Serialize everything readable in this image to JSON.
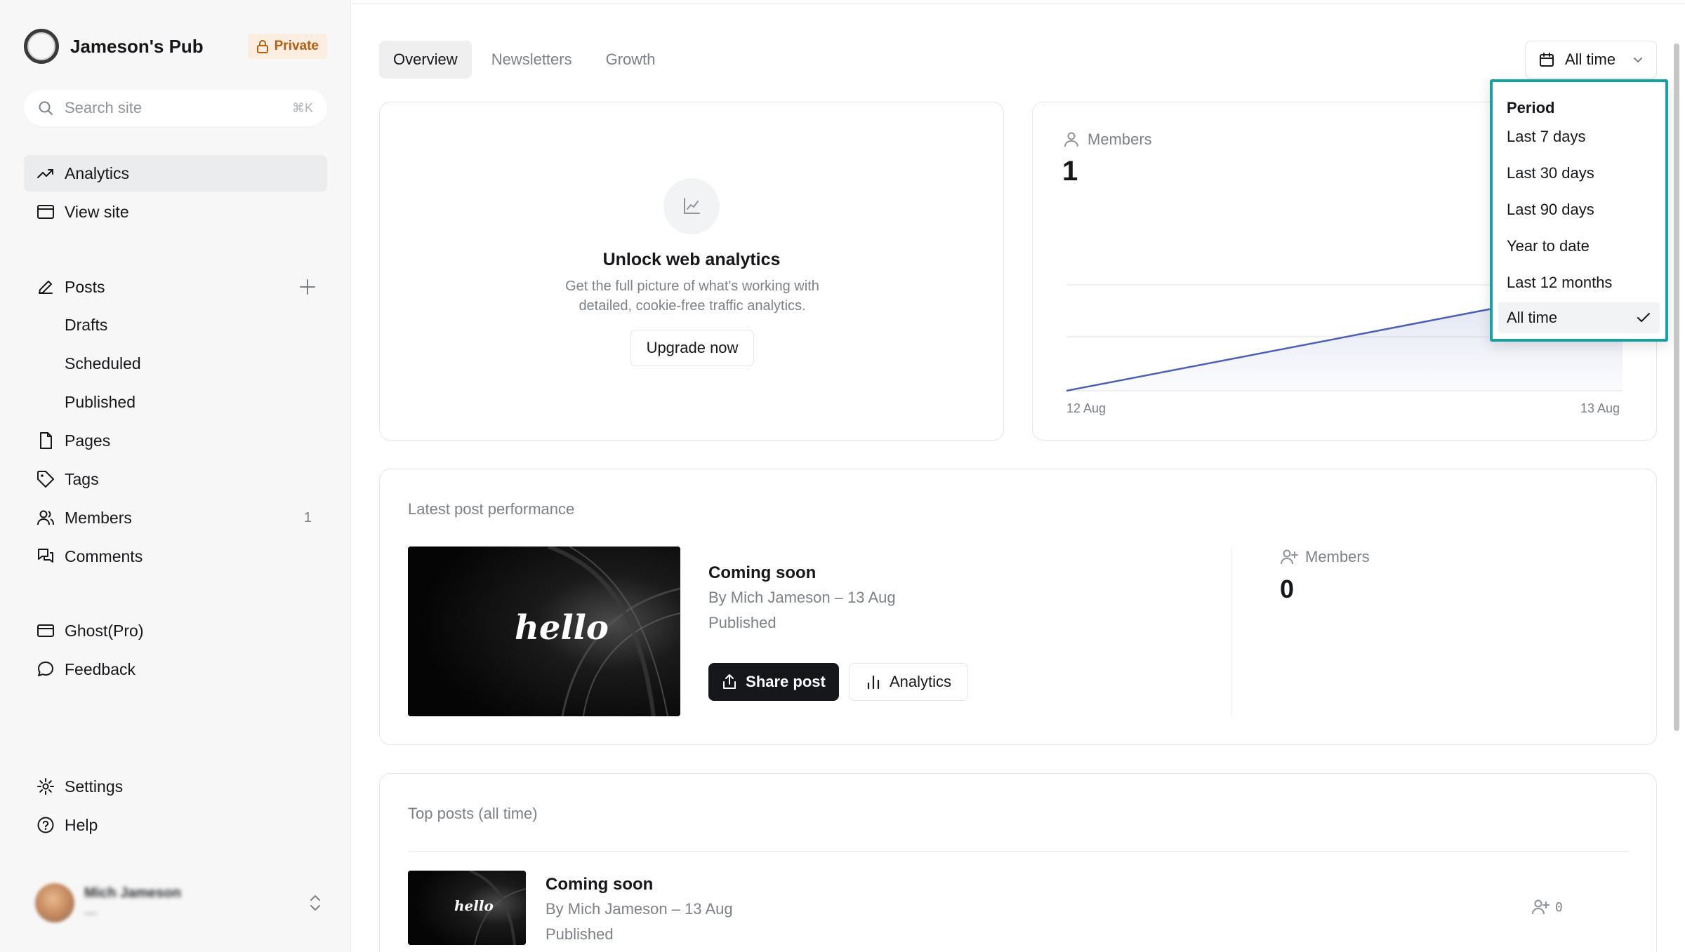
{
  "site": {
    "name": "Jameson's Pub",
    "badge": "Private"
  },
  "search": {
    "placeholder": "Search site",
    "shortcut": "⌘K"
  },
  "nav": {
    "analytics": "Analytics",
    "view_site": "View site",
    "posts": "Posts",
    "drafts": "Drafts",
    "scheduled": "Scheduled",
    "published": "Published",
    "pages": "Pages",
    "tags": "Tags",
    "members": "Members",
    "members_count": "1",
    "comments": "Comments",
    "ghost_pro": "Ghost(Pro)",
    "feedback": "Feedback",
    "settings": "Settings",
    "help": "Help"
  },
  "user": {
    "name": "Mich Jameson",
    "email": "—"
  },
  "tabs": [
    "Overview",
    "Newsletters",
    "Growth"
  ],
  "period": {
    "current": "All time",
    "heading": "Period",
    "options": [
      "Last 7 days",
      "Last 30 days",
      "Last 90 days",
      "Year to date",
      "Last 12 months",
      "All time"
    ]
  },
  "unlock": {
    "title": "Unlock web analytics",
    "description": "Get the full picture of what's working with detailed, cookie-free traffic analytics.",
    "button": "Upgrade now"
  },
  "members_card": {
    "label": "Members",
    "value": "1",
    "chart_data": {
      "type": "area",
      "x": [
        "12 Aug",
        "13 Aug"
      ],
      "values": [
        0,
        1
      ]
    }
  },
  "latest": {
    "title": "Latest post performance",
    "thumb_text": "hello",
    "post_title": "Coming soon",
    "post_meta": "By Mich Jameson – 13 Aug",
    "post_status": "Published",
    "share_label": "Share post",
    "analytics_label": "Analytics",
    "members_label": "Members",
    "members_value": "0"
  },
  "top_posts": {
    "title": "Top posts (all time)",
    "thumb_text": "hello",
    "post_title": "Coming soon",
    "post_meta": "By Mich Jameson – 13 Aug",
    "post_status": "Published",
    "members_value": "0"
  },
  "colors": {
    "accent_outline": "#17a2a2",
    "chart_line": "#4a5fb5",
    "badge_bg": "#fbeee0",
    "badge_text": "#b85e12"
  }
}
